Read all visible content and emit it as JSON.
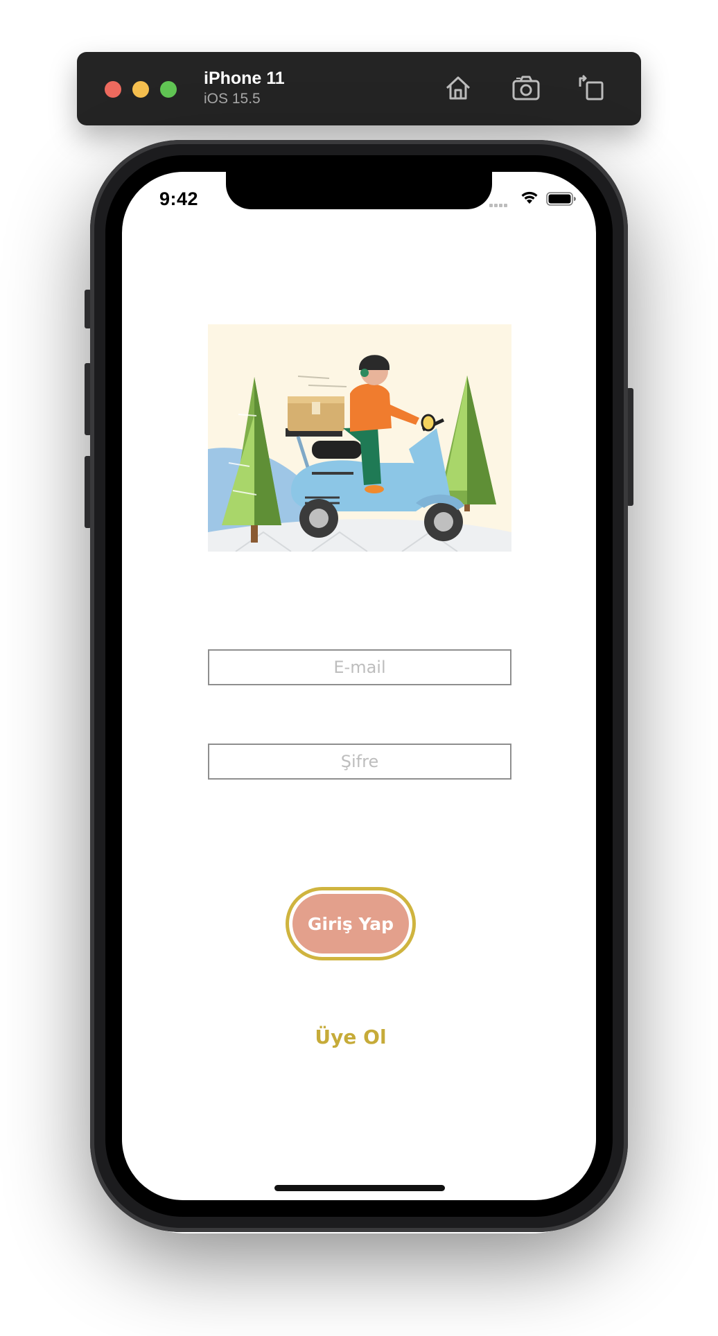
{
  "simulator": {
    "device_name": "iPhone 11",
    "os_version": "iOS 15.5",
    "toolbar_icons": [
      "home-icon",
      "screenshot-icon",
      "rotate-icon"
    ],
    "traffic_light_colors": [
      "#ed6a5e",
      "#f5bf4f",
      "#61c554"
    ]
  },
  "status_bar": {
    "time": "9:42",
    "icons": [
      "cellular-signal-icon",
      "wifi-icon",
      "battery-icon"
    ]
  },
  "app": {
    "hero_image": "delivery-scooter-illustration",
    "email_placeholder": "E-mail",
    "password_placeholder": "Şifre",
    "login_button_label": "Giriş Yap",
    "signup_link_label": "Üye Ol",
    "colors": {
      "button_fill": "#e3a08c",
      "button_border": "#cfb43f",
      "link": "#c6ab39",
      "field_border": "#8e8e8e"
    }
  }
}
